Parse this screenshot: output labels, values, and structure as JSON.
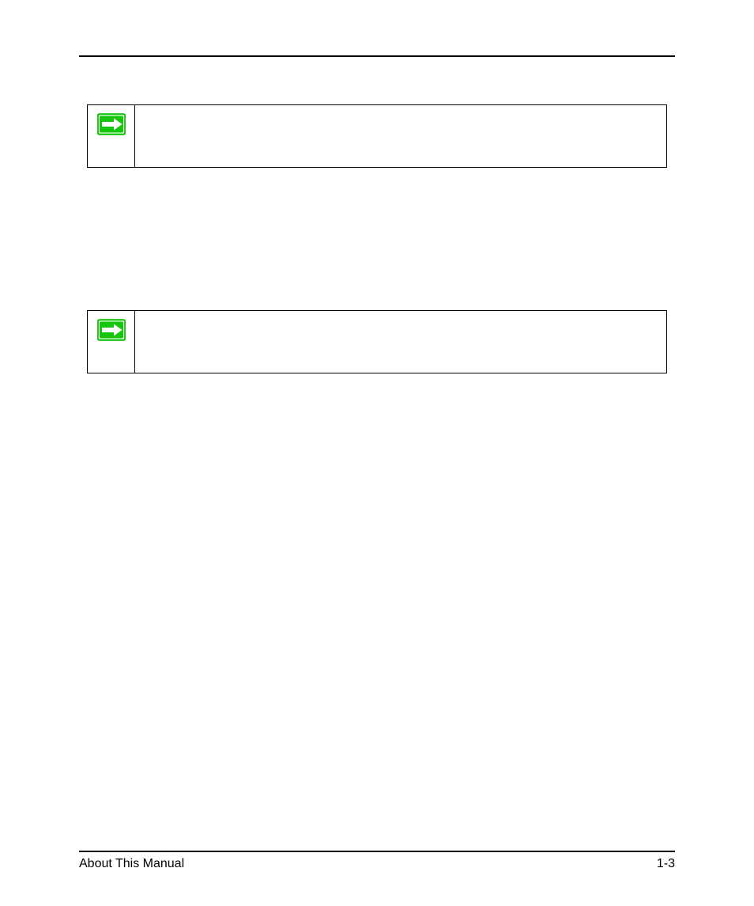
{
  "notes": [
    {
      "text": ""
    },
    {
      "text": ""
    }
  ],
  "footer": {
    "left": "About This Manual",
    "right": "1-3"
  },
  "icon_color": "#16c60c"
}
